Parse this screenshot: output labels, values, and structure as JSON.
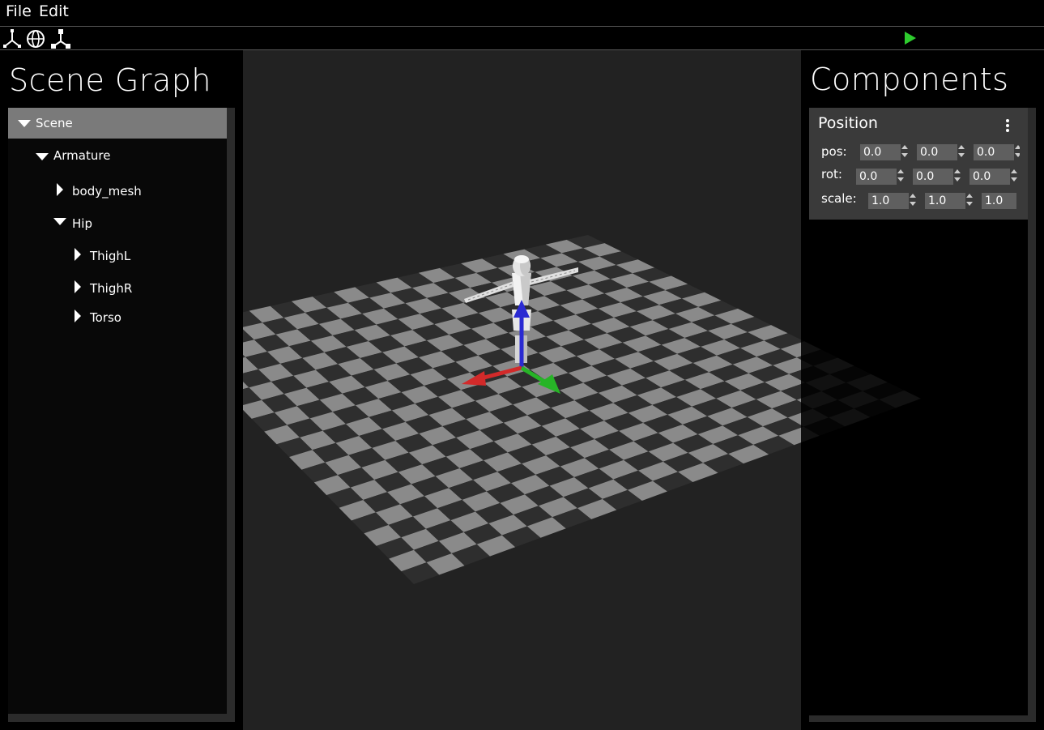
{
  "menubar": {
    "file_label": "File",
    "edit_label": "Edit"
  },
  "toolbar": {
    "tools": [
      "translate-gizmo-icon",
      "rotate-gizmo-icon",
      "scale-gizmo-icon"
    ],
    "play_icon": "play-icon",
    "play_color": "#2ecc2e"
  },
  "scene_graph": {
    "title": "Scene Graph",
    "nodes": [
      {
        "label": "Scene",
        "expanded": true,
        "selected": true
      },
      {
        "label": "Armature",
        "expanded": true
      },
      {
        "label": "body_mesh",
        "expanded": false
      },
      {
        "label": "Hip",
        "expanded": true
      },
      {
        "label": "ThighL",
        "expanded": false
      },
      {
        "label": "ThighR",
        "expanded": false
      },
      {
        "label": "Torso",
        "expanded": false
      }
    ]
  },
  "components": {
    "title": "Components",
    "position_card": {
      "title": "Position",
      "menu_icon": "kebab-menu-icon",
      "rows": [
        {
          "label": "pos:",
          "values": [
            "0.0",
            "0.0",
            "0.0"
          ]
        },
        {
          "label": "rot:",
          "values": [
            "0.0",
            "0.0",
            "0.0"
          ]
        },
        {
          "label": "scale:",
          "values": [
            "1.0",
            "1.0",
            "1.0"
          ]
        }
      ]
    }
  },
  "viewport": {
    "floor": "checkerboard-grid",
    "model": "t-pose-humanoid",
    "gizmo_colors": {
      "x": "#d22a2a",
      "y": "#2a2ad2",
      "z": "#27b427"
    }
  }
}
